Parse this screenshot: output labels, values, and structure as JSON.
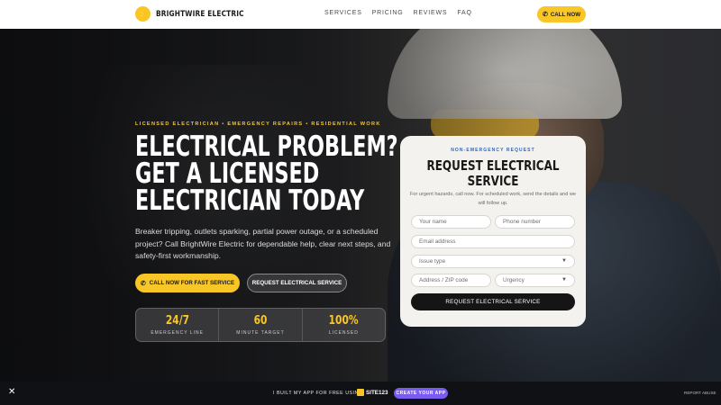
{
  "brand": {
    "name": "BRIGHTWIRE ELECTRIC",
    "icon": "lightning-bolt-icon"
  },
  "nav": {
    "links": [
      "SERVICES",
      "PRICING",
      "REVIEWS",
      "FAQ"
    ],
    "call_label": "CALL NOW"
  },
  "hero": {
    "eyebrow": "LICENSED ELECTRICIAN • EMERGENCY REPAIRS • RESIDENTIAL WORK",
    "headline": [
      "ELECTRICAL PROBLEM?",
      "GET A LICENSED",
      "ELECTRICIAN TODAY"
    ],
    "lede": "Breaker tripping, outlets sparking, partial power outage, or a scheduled project? Call BrightWire Electric for dependable help, clear next steps, and safety-first workmanship.",
    "cta_call": "CALL NOW FOR FAST SERVICE",
    "cta_request": "REQUEST ELECTRICAL SERVICE",
    "stats": [
      {
        "value": "24/7",
        "label": "EMERGENCY LINE"
      },
      {
        "value": "60",
        "label": "MINUTE TARGET"
      },
      {
        "value": "100%",
        "label": "LICENSED"
      }
    ]
  },
  "form": {
    "eyebrow": "NON-EMERGENCY REQUEST",
    "title": [
      "REQUEST ELECTRICAL",
      "SERVICE"
    ],
    "note": "For urgent hazards, call now. For scheduled work, send the details and we will follow up.",
    "fields": {
      "name": "Your name",
      "phone": "Phone number",
      "email": "Email address",
      "issue": "Issue type",
      "address": "Address / ZIP code",
      "urgency": "Urgency"
    },
    "submit": "REQUEST ELECTRICAL SERVICE"
  },
  "footer_bar": {
    "built_text": "I BUILT MY APP FOR FREE USING",
    "site_logo": "SITE123",
    "create_label": "CREATE YOUR APP",
    "report_label": "REPORT ABUSE"
  },
  "colors": {
    "accent": "#f8c727",
    "eyebrow_blue": "#2f64b8",
    "create_purple": "#7b5cf0"
  }
}
